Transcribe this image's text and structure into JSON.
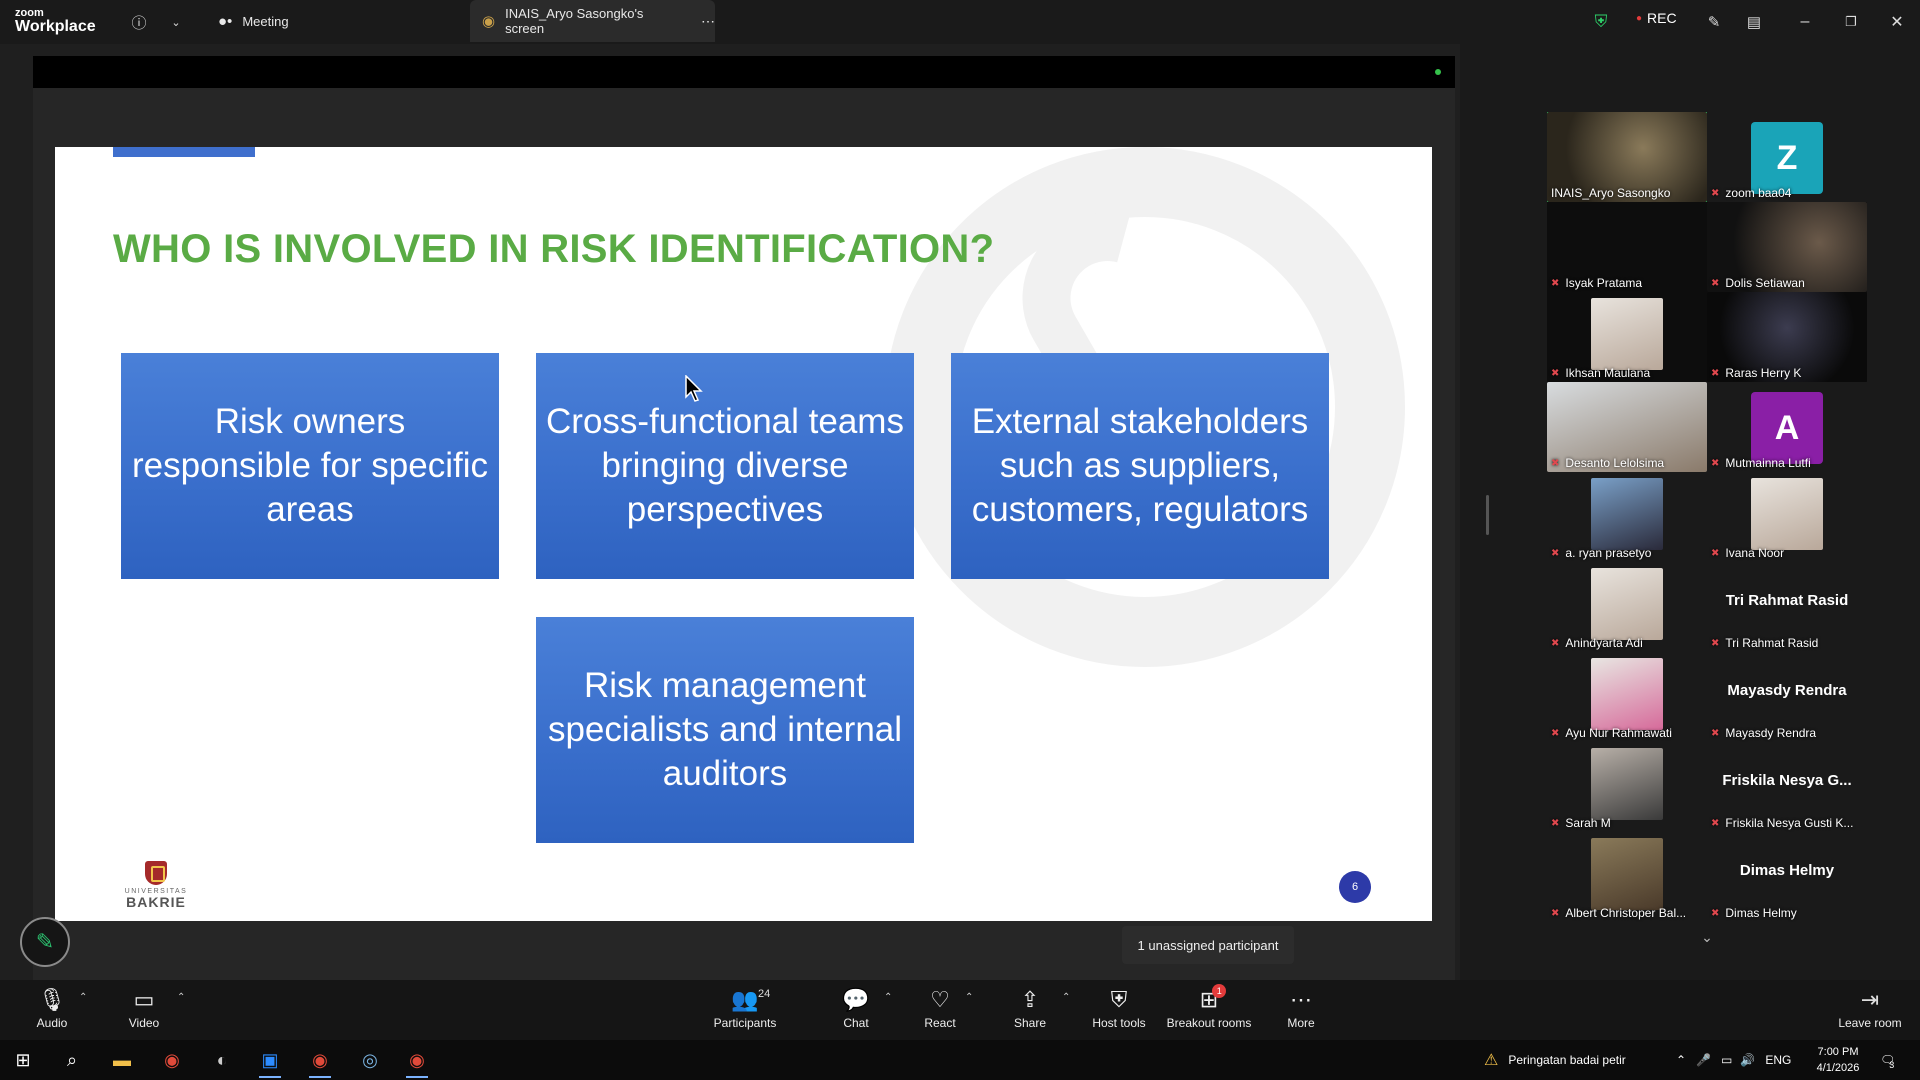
{
  "titlebar": {
    "logo_top": "zoom",
    "logo_bottom": "Workplace",
    "tabs": [
      {
        "label": "Meeting"
      },
      {
        "label": "INAIS_Aryo Sasongko's screen"
      }
    ],
    "rec_label": "REC"
  },
  "slide": {
    "title": "WHO IS INVOLVED IN RISK IDENTIFICATION?",
    "boxes": [
      "Risk owners responsible for specific areas",
      "Cross-functional teams bringing diverse perspectives",
      "External stakeholders such as suppliers, customers, regulators",
      "Risk management specialists and internal auditors"
    ],
    "logo_small": "UNIVERSITAS",
    "logo_big": "BAKRIE",
    "page_number": "6"
  },
  "tooltip": "1 unassigned participant",
  "gallery": {
    "tiles": [
      {
        "name": "INAIS_Aryo Sasongko",
        "kind": "photo-full",
        "active": true
      },
      {
        "name": "zoom baa04",
        "kind": "avatar",
        "letter": "Z",
        "color": "#1aa4b8"
      },
      {
        "name": "Isyak Pratama",
        "kind": "blank"
      },
      {
        "name": "Dolis Setiawan",
        "kind": "photo-full"
      },
      {
        "name": "Ikhsan Maulana",
        "kind": "photo"
      },
      {
        "name": "Raras Herry K",
        "kind": "photo-dark"
      },
      {
        "name": "Desanto Lelolsima",
        "kind": "photo-full-light"
      },
      {
        "name": "Mutmainna Lutfi",
        "kind": "avatar",
        "letter": "A",
        "color": "#8a1fa6"
      },
      {
        "name": "a. ryan prasetyo",
        "kind": "photo"
      },
      {
        "name": "Ivana Noor",
        "kind": "photo-light"
      },
      {
        "name": "Anindyarta Adi",
        "kind": "photo-light"
      },
      {
        "name": "Tri Rahmat Rasid",
        "kind": "name",
        "big": "Tri Rahmat Rasid"
      },
      {
        "name": "Ayu Nur Rahmawati",
        "kind": "photo-light"
      },
      {
        "name": "Mayasdy Rendra",
        "kind": "name",
        "big": "Mayasdy Rendra"
      },
      {
        "name": "Sarah M",
        "kind": "photo"
      },
      {
        "name": "Friskila Nesya Gusti K...",
        "kind": "name",
        "big": "Friskila Nesya G..."
      },
      {
        "name": "Albert Christoper Bal...",
        "kind": "photo"
      },
      {
        "name": "Dimas Helmy",
        "kind": "name",
        "big": "Dimas Helmy"
      }
    ]
  },
  "toolbar": {
    "audio": "Audio",
    "video": "Video",
    "participants": "Participants",
    "participants_count": "24",
    "chat": "Chat",
    "react": "React",
    "share": "Share",
    "host_tools": "Host tools",
    "breakout": "Breakout rooms",
    "breakout_badge": "1",
    "more": "More",
    "leave": "Leave room"
  },
  "taskbar": {
    "weather": "Peringatan badai petir",
    "lang": "ENG",
    "time": "7:00 PM",
    "date": "4/1/2026",
    "notif": "3"
  },
  "colors": {
    "title_green": "#5aab45",
    "box_blue": "#3a6fcc",
    "active_border": "#2ed26a",
    "rec_red": "#e23b3b"
  }
}
